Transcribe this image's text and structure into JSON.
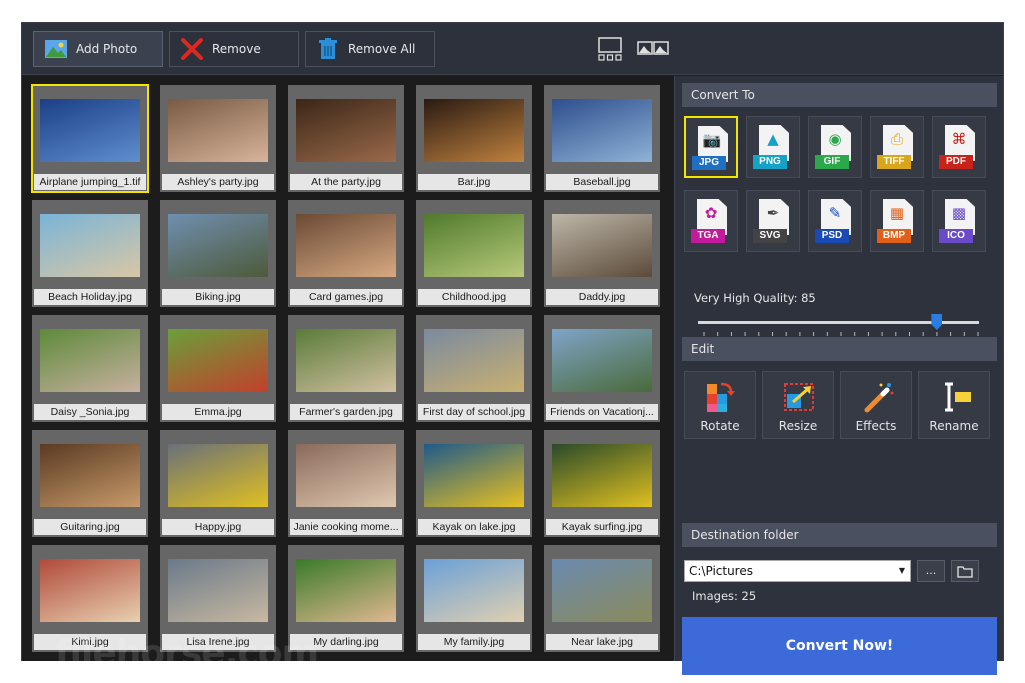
{
  "toolbar": {
    "add_label": "Add Photo",
    "remove_label": "Remove",
    "remove_all_label": "Remove All"
  },
  "photos": [
    {
      "name": "Airplane jumping_1.tif",
      "colors": [
        "#1b3f86",
        "#5f8fce"
      ]
    },
    {
      "name": "Ashley's party.jpg",
      "colors": [
        "#7a5a44",
        "#d7b49a"
      ]
    },
    {
      "name": "At the party.jpg",
      "colors": [
        "#3b2617",
        "#9a6a4a"
      ]
    },
    {
      "name": "Bar.jpg",
      "colors": [
        "#2a1a12",
        "#c0823f"
      ]
    },
    {
      "name": "Baseball.jpg",
      "colors": [
        "#2d4f8c",
        "#8fb2d8"
      ]
    },
    {
      "name": "Beach Holiday.jpg",
      "colors": [
        "#7ab4d8",
        "#d8c7a5"
      ]
    },
    {
      "name": "Biking.jpg",
      "colors": [
        "#6f8fb0",
        "#4e5a3a"
      ]
    },
    {
      "name": "Card games.jpg",
      "colors": [
        "#6a4a34",
        "#d7a982"
      ]
    },
    {
      "name": "Childhood.jpg",
      "colors": [
        "#4f7a2c",
        "#b8c97a"
      ]
    },
    {
      "name": "Daddy.jpg",
      "colors": [
        "#bdb7a8",
        "#5c4a3a"
      ]
    },
    {
      "name": "Daisy _Sonia.jpg",
      "colors": [
        "#5e8a3a",
        "#c7b0a0"
      ]
    },
    {
      "name": "Emma.jpg",
      "colors": [
        "#6aa03a",
        "#c2402c"
      ]
    },
    {
      "name": "Farmer's garden.jpg",
      "colors": [
        "#5a7b3a",
        "#d2c0a0"
      ]
    },
    {
      "name": "First day of school.jpg",
      "colors": [
        "#7a8aa0",
        "#c9b070"
      ]
    },
    {
      "name": "Friends on Vacationj...",
      "colors": [
        "#7fa4c8",
        "#4a6a3a"
      ]
    },
    {
      "name": "Guitaring.jpg",
      "colors": [
        "#5a3a22",
        "#c79a6a"
      ]
    },
    {
      "name": "Happy.jpg",
      "colors": [
        "#6a707a",
        "#e0c020"
      ]
    },
    {
      "name": "Janie cooking mome...",
      "colors": [
        "#8a6a5a",
        "#e0c8b0"
      ]
    },
    {
      "name": "Kayak on lake.jpg",
      "colors": [
        "#1f5a8a",
        "#e8c020"
      ]
    },
    {
      "name": "Kayak surfing.jpg",
      "colors": [
        "#2a4a2a",
        "#e0c020"
      ]
    },
    {
      "name": "Kimi.jpg",
      "colors": [
        "#b04a3a",
        "#e8d0b0"
      ]
    },
    {
      "name": "Lisa Irene.jpg",
      "colors": [
        "#6a7a8a",
        "#c8b8a0"
      ]
    },
    {
      "name": "My darling.jpg",
      "colors": [
        "#3a7a2a",
        "#e0b890"
      ]
    },
    {
      "name": "My family.jpg",
      "colors": [
        "#6aa0d8",
        "#e0d0b0"
      ]
    },
    {
      "name": "Near lake.jpg",
      "colors": [
        "#6a8ab0",
        "#8a8a5a"
      ]
    }
  ],
  "convert_to": {
    "header": "Convert To",
    "formats": [
      {
        "label": "JPG",
        "color": "#1f6fc2",
        "icon": "camera-icon",
        "glyph": "📷"
      },
      {
        "label": "PNG",
        "color": "#14a3c7",
        "icon": "landscape-icon",
        "glyph": "▲"
      },
      {
        "label": "GIF",
        "color": "#2aa84a",
        "icon": "color-wheel-icon",
        "glyph": "◉"
      },
      {
        "label": "TIFF",
        "color": "#d9a51a",
        "icon": "printer-icon",
        "glyph": "⎙"
      },
      {
        "label": "PDF",
        "color": "#c8221a",
        "icon": "acrobat-icon",
        "glyph": "⌘"
      },
      {
        "label": "TGA",
        "color": "#c21a9a",
        "icon": "rgb-circles-icon",
        "glyph": "✿"
      },
      {
        "label": "SVG",
        "color": "#444444",
        "icon": "vector-pen-icon",
        "glyph": "✒"
      },
      {
        "label": "PSD",
        "color": "#1a4ab8",
        "icon": "brush-icon",
        "glyph": "✎"
      },
      {
        "label": "BMP",
        "color": "#e0601a",
        "icon": "windows-icon",
        "glyph": "▦"
      },
      {
        "label": "ICO",
        "color": "#6a4ac8",
        "icon": "grid-icon",
        "glyph": "▩"
      }
    ],
    "quality_label": "Very High Quality: 85",
    "quality_value": 85
  },
  "edit": {
    "header": "Edit",
    "buttons": [
      {
        "label": "Rotate"
      },
      {
        "label": "Resize"
      },
      {
        "label": "Effects"
      },
      {
        "label": "Rename"
      }
    ]
  },
  "destination": {
    "header": "Destination folder",
    "path": "C:\\Pictures",
    "browse_label": "...",
    "images_count": "Images: 25"
  },
  "convert_button": "Convert Now!",
  "watermark": "filehorse.com",
  "accent": "#3d6ad9",
  "selection_color": "#f2e600"
}
